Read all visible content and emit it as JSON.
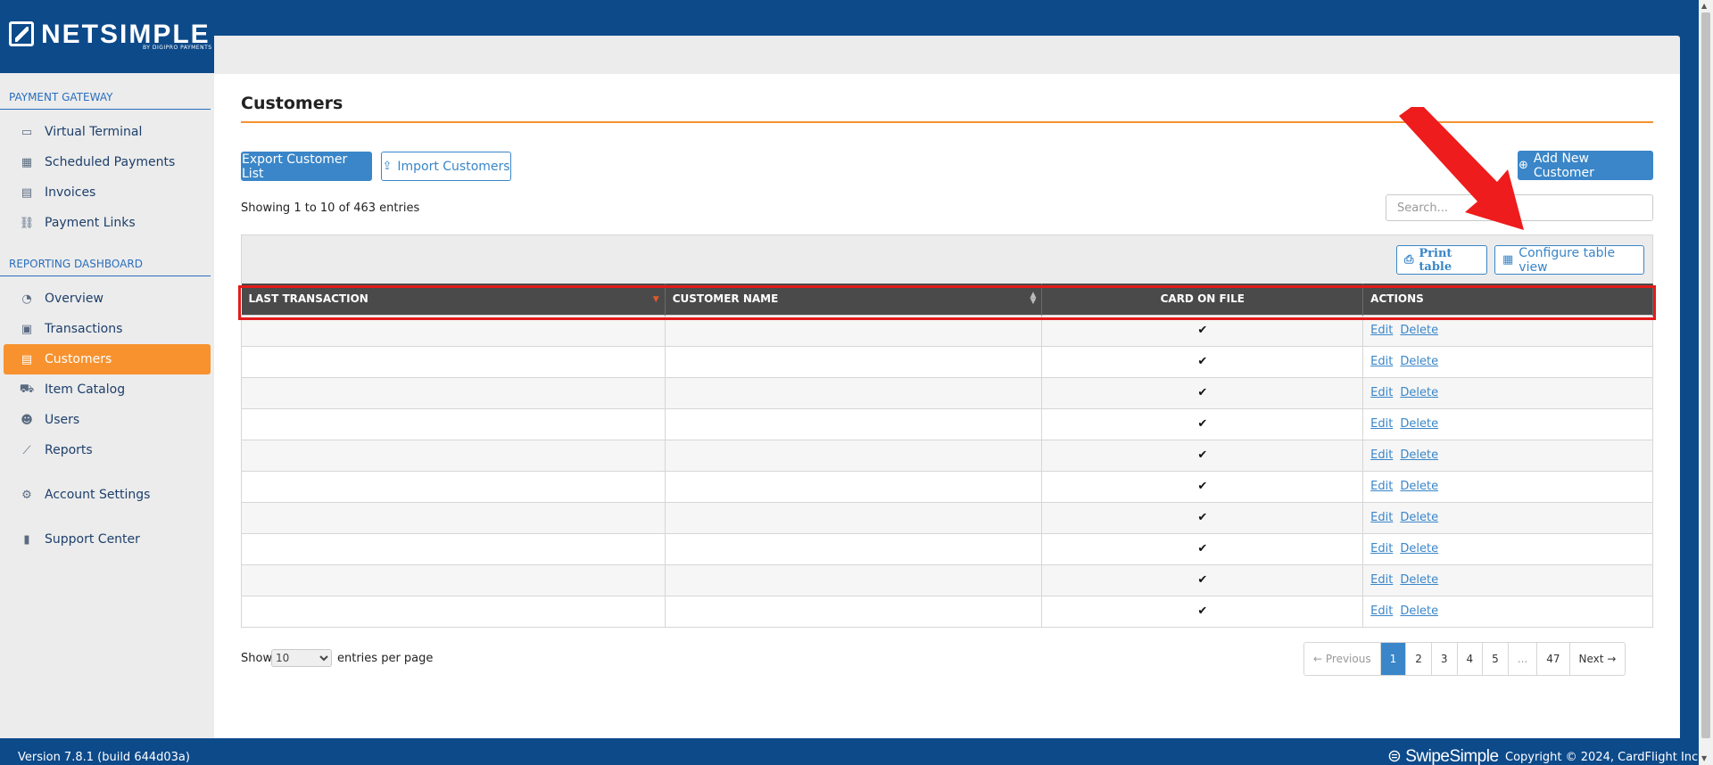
{
  "brand": {
    "name": "NETSIMPLE",
    "sub": "BY DIGIPRO PAYMENTS"
  },
  "sidebar": {
    "sections": [
      {
        "label": "PAYMENT GATEWAY",
        "items": [
          {
            "label": "Virtual Terminal",
            "icon": "credit-card-icon"
          },
          {
            "label": "Scheduled Payments",
            "icon": "calendar-icon"
          },
          {
            "label": "Invoices",
            "icon": "file-icon"
          },
          {
            "label": "Payment Links",
            "icon": "link-icon"
          }
        ]
      },
      {
        "label": "REPORTING DASHBOARD",
        "items": [
          {
            "label": "Overview",
            "icon": "dashboard-icon"
          },
          {
            "label": "Transactions",
            "icon": "money-icon"
          },
          {
            "label": "Customers",
            "icon": "id-card-icon",
            "active": true
          },
          {
            "label": "Item Catalog",
            "icon": "cart-icon"
          },
          {
            "label": "Users",
            "icon": "users-icon"
          },
          {
            "label": "Reports",
            "icon": "chart-icon"
          }
        ]
      }
    ],
    "extra": [
      {
        "label": "Account Settings",
        "icon": "gear-icon"
      },
      {
        "label": "Support Center",
        "icon": "book-icon"
      }
    ]
  },
  "page": {
    "title": "Customers",
    "export_label": "Export Customer List",
    "import_label": "Import Customers",
    "add_label": "Add New Customer",
    "entries_info": "Showing 1 to 10 of 463 entries",
    "search_placeholder": "Search...",
    "print_label": "Print table",
    "config_label": "Configure table view"
  },
  "table": {
    "columns": [
      "LAST TRANSACTION",
      "CUSTOMER NAME",
      "CARD ON FILE",
      "ACTIONS"
    ],
    "rows": [
      {
        "last_transaction": "",
        "customer_name": "",
        "card_on_file": "✔",
        "edit": "Edit",
        "delete": "Delete"
      },
      {
        "last_transaction": "",
        "customer_name": "",
        "card_on_file": "✔",
        "edit": "Edit",
        "delete": "Delete"
      },
      {
        "last_transaction": "",
        "customer_name": "",
        "card_on_file": "✔",
        "edit": "Edit",
        "delete": "Delete"
      },
      {
        "last_transaction": "",
        "customer_name": "",
        "card_on_file": "✔",
        "edit": "Edit",
        "delete": "Delete"
      },
      {
        "last_transaction": "",
        "customer_name": "",
        "card_on_file": "✔",
        "edit": "Edit",
        "delete": "Delete"
      },
      {
        "last_transaction": "",
        "customer_name": "",
        "card_on_file": "✔",
        "edit": "Edit",
        "delete": "Delete"
      },
      {
        "last_transaction": "",
        "customer_name": "",
        "card_on_file": "✔",
        "edit": "Edit",
        "delete": "Delete"
      },
      {
        "last_transaction": "",
        "customer_name": "",
        "card_on_file": "✔",
        "edit": "Edit",
        "delete": "Delete"
      },
      {
        "last_transaction": "",
        "customer_name": "",
        "card_on_file": "✔",
        "edit": "Edit",
        "delete": "Delete"
      },
      {
        "last_transaction": "",
        "customer_name": "",
        "card_on_file": "✔",
        "edit": "Edit",
        "delete": "Delete"
      }
    ]
  },
  "pagination": {
    "show_label": "Show",
    "per_page_value": "10",
    "per_page_label": "entries per page",
    "items": [
      {
        "label": "← Previous",
        "state": "disabled"
      },
      {
        "label": "1",
        "state": "active"
      },
      {
        "label": "2",
        "state": ""
      },
      {
        "label": "3",
        "state": ""
      },
      {
        "label": "4",
        "state": ""
      },
      {
        "label": "5",
        "state": ""
      },
      {
        "label": "...",
        "state": "disabled"
      },
      {
        "label": "47",
        "state": ""
      },
      {
        "label": "Next →",
        "state": ""
      }
    ]
  },
  "footer": {
    "version": "Version 7.8.1 (build 644d03a)",
    "swipe_logo": "SwipeSimple",
    "copyright": "Copyright © 2024, CardFlight Inc."
  },
  "colors": {
    "brand_blue": "#0d4a8a",
    "accent_orange": "#f7922e",
    "link_blue": "#3a86c8",
    "annotation_red": "#e31b1b"
  }
}
